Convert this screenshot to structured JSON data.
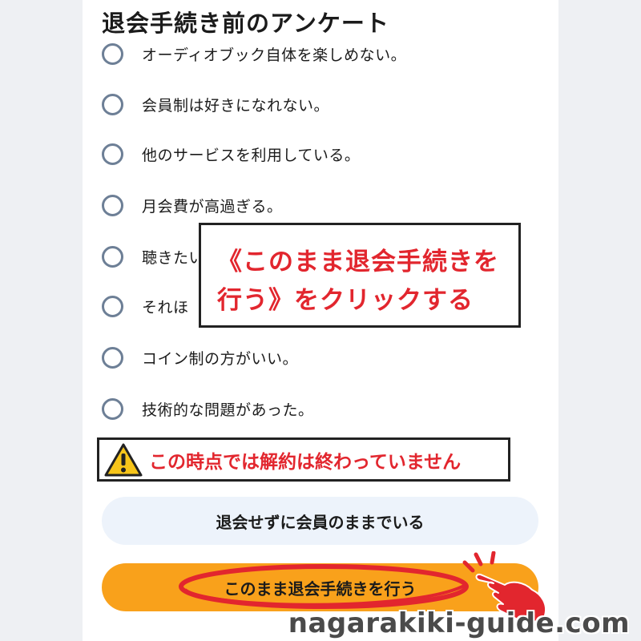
{
  "survey": {
    "title": "退会手続き前のアンケート",
    "options": [
      "オーディオブック自体を楽しめない。",
      "会員制は好きになれない。",
      "他のサービスを利用している。",
      "月会費が高過ぎる。",
      "聴きたい",
      "それほ",
      "コイン制の方がいい。",
      "技術的な問題があった。"
    ]
  },
  "callout": {
    "line1": "《このまま退会手続きを",
    "line2": "行う》をクリックする"
  },
  "warning": {
    "text": "この時点では解約は終わっていません"
  },
  "buttons": {
    "stay_label": "退会せずに会員のままでいる",
    "cancel_label": "このまま退会手続きを行う"
  },
  "watermark": "nagarakiki-guide.com",
  "colors": {
    "accent_red": "#e2262e",
    "cancel_button": "#f9a11b",
    "stay_button": "#edf3fb",
    "radio_border": "#6d7f96"
  }
}
